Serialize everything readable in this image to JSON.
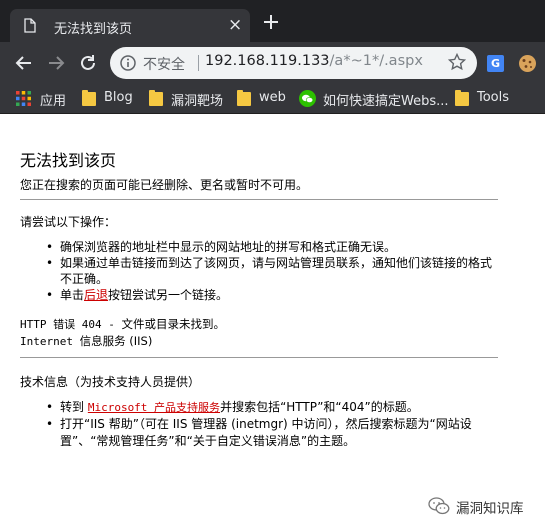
{
  "browser": {
    "tab": {
      "title": "无法找到该页",
      "close": "×",
      "page_icon": "document-icon"
    },
    "omnibox": {
      "security_label": "不安全",
      "url_host": "192.168.119.133",
      "url_path": "/a*~1*/.aspx"
    },
    "bookmarks": [
      {
        "label": "应用",
        "icon": "apps-grid-icon"
      },
      {
        "label": "Blog",
        "icon": "folder-icon"
      },
      {
        "label": "漏洞靶场",
        "icon": "folder-icon"
      },
      {
        "label": "web",
        "icon": "folder-icon"
      },
      {
        "label": "如何快速搞定Webs...",
        "icon": "wechat-icon"
      },
      {
        "label": "Tools",
        "icon": "folder-icon"
      }
    ],
    "extensions": {
      "translate_label": "G"
    },
    "colors": {
      "tabstrip": "#202124",
      "toolbar": "#35363a",
      "omnibox": "#f1f3f4",
      "folder": "#f5c842"
    }
  },
  "page": {
    "heading": "无法找到该页",
    "subtitle": "您正在搜索的页面可能已经删除、更名或暂时不可用。",
    "try_heading": "请尝试以下操作：",
    "steps": {
      "s1": "确保浏览器的地址栏中显示的网站地址的拼写和格式正确无误。",
      "s2": "如果通过单击链接而到达了该网页，请与网站管理员联系，通知他们该链接的格式不正确。",
      "s3_pre": "单击",
      "s3_link": "后退",
      "s3_post": "按钮尝试另一个链接。"
    },
    "error_line": {
      "code": "HTTP 错误 404 - ",
      "text": "文件或目录未找到。"
    },
    "service_line": {
      "code": "Internet ",
      "text": "信息服务 (IIS)"
    },
    "tech_heading": "技术信息（为技术支持人员提供）",
    "tech": {
      "t1_pre": "转到 ",
      "t1_link": "Microsoft 产品支持服务",
      "t1_post": "并搜索包括“HTTP”和“404”的标题。",
      "t2": "打开“IIS 帮助”（可在 IIS 管理器 (inetmgr) 中访问），然后搜索标题为“网站设置”、“常规管理任务”和“关于自定义错误消息”的主题。"
    },
    "link_color": "#cc0000"
  },
  "watermark": {
    "text": "漏洞知识库",
    "icon": "wechat-official-account-icon"
  }
}
